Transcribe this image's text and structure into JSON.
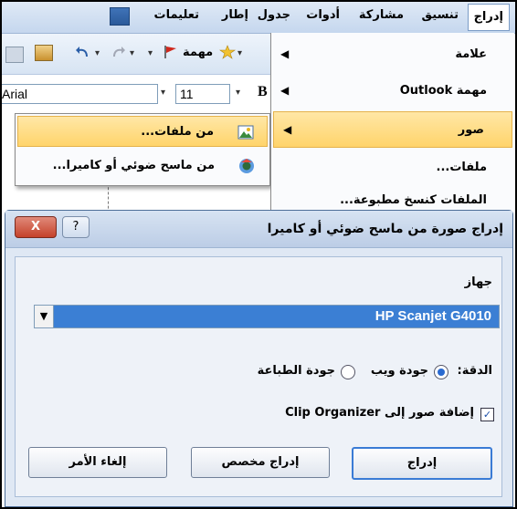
{
  "menubar": {
    "items": [
      "إدراج",
      "تنسيق",
      "مشاركة",
      "أدوات",
      "جدول",
      "إطار",
      "تعليمات"
    ]
  },
  "toolbar": {
    "task_label": "مهمة",
    "font_name": "Arial",
    "font_size": "11"
  },
  "picture_submenu": {
    "items": [
      "من ملفات...",
      "من ماسح ضوئي أو كاميرا..."
    ]
  },
  "insert_menu": {
    "items": [
      "علامة",
      "مهمة Outlook",
      "صور",
      "ملفات...",
      "الملفات كنسخ مطبوعة..."
    ]
  },
  "dialog": {
    "title": "إدراج صورة من ماسح ضوئي أو كاميرا",
    "help_label": "?",
    "close_label": "X",
    "device_label": "جهاز",
    "device_value": "HP Scanjet G4010",
    "resolution_label": "الدقة:",
    "web_quality_label": "جودة ويب",
    "print_quality_label": "جودة الطباعة",
    "clip_organizer_label": "إضافة صور إلى Clip Organizer",
    "insert_button": "إدراج",
    "custom_insert_button": "إدراج مخصص",
    "cancel_button": "إلغاء الأمر",
    "selected_resolution": "جودة ويب",
    "clip_organizer_checked": true
  },
  "colors": {
    "highlight": "#ffd46b",
    "selection_blue": "#3b7fd4",
    "dialog_bg": "#dfe8f4"
  }
}
